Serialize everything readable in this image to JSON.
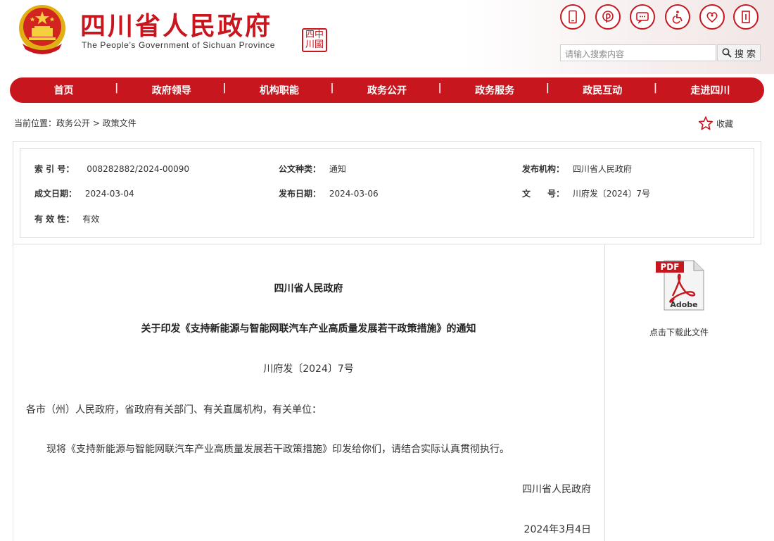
{
  "header": {
    "site_title": "四川省人民政府",
    "site_subtitle": "The People’s Government of Sichuan Province",
    "seal_text": "四中川國",
    "tool_icons": [
      "mobile-icon",
      "weibo-icon",
      "message-icon",
      "accessibility-icon",
      "elderly-care-icon",
      "exit-icon"
    ],
    "search_placeholder": "请输入搜索内容",
    "search_button": "搜 索",
    "brand_color": "#c8161e"
  },
  "nav": {
    "items": [
      "首页",
      "政府领导",
      "机构职能",
      "政务公开",
      "政务服务",
      "政民互动",
      "走进四川"
    ]
  },
  "breadcrumb": {
    "text": "当前位置：政务公开 > 政策文件",
    "favorite": "收藏"
  },
  "meta": {
    "index_label": "索 引 号：",
    "index_value": "008282882/2024-00090",
    "type_label": "公文种类：",
    "type_value": "通知",
    "org_label": "发布机构：",
    "org_value": "四川省人民政府",
    "written_label": "成文日期：",
    "written_value": "2024-03-04",
    "publish_label": "发布日期：",
    "publish_value": "2024-03-06",
    "docno_label": "文　　号：",
    "docno_value": "川府发〔2024〕7号",
    "valid_label": "有 效 性：",
    "valid_value": "有效"
  },
  "document": {
    "issuer": "四川省人民政府",
    "title": "关于印发《支持新能源与智能网联汽车产业高质量发展若干政策措施》的通知",
    "number": "川府发〔2024〕7号",
    "recipient": "各市（州）人民政府，省政府有关部门、有关直属机构，有关单位：",
    "body": "现将《支持新能源与智能网联汽车产业高质量发展若干政策措施》印发给你们，请结合实际认真贯彻执行。",
    "sign": "四川省人民政府",
    "date": "2024年3月4日"
  },
  "attachment": {
    "pdf_label": "PDF",
    "adobe_label": "Adobe",
    "download_text": "点击下载此文件"
  }
}
